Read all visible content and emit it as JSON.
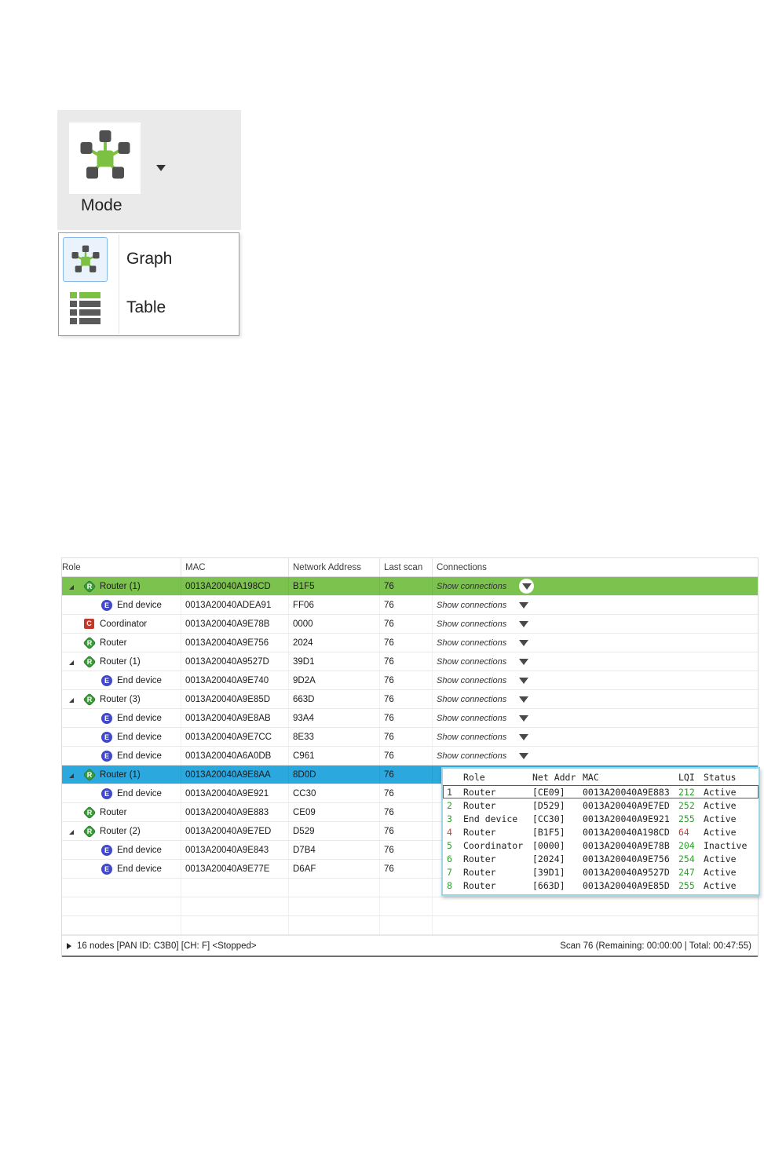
{
  "colors": {
    "green_highlight": "#7CC24E",
    "blue_highlight": "#2BA9DF",
    "accent_green": "#7CC142",
    "icon_dark": "#4F4F4F",
    "lqi_green": "#2E9E2E",
    "lqi_red": "#D23B3B",
    "router_icon": "#3D9B3D",
    "end_device_icon": "#4149C8",
    "coordinator_icon": "#C0392B",
    "selected_item_border": "#86B8E8"
  },
  "mode_widget": {
    "label": "Mode",
    "menu": [
      {
        "label": "Graph",
        "selected": true
      },
      {
        "label": "Table",
        "selected": false
      }
    ]
  },
  "table": {
    "columns": [
      "Role",
      "MAC",
      "Network Address",
      "Last scan",
      "Connections"
    ],
    "show_connections_label": "Show connections",
    "icon_letters": {
      "router": "R",
      "end": "E",
      "coord": "C"
    },
    "rows": [
      {
        "type": "router",
        "expander": true,
        "child": false,
        "role": "Router (1)",
        "mac": "0013A20040A198CD",
        "net": "B1F5",
        "scan": "76",
        "highlight": "green",
        "conn": "circle"
      },
      {
        "type": "end",
        "expander": false,
        "child": true,
        "role": "End device",
        "mac": "0013A20040ADEA91",
        "net": "FF06",
        "scan": "76",
        "highlight": "",
        "conn": "plain"
      },
      {
        "type": "coord",
        "expander": false,
        "child": false,
        "role": "Coordinator",
        "mac": "0013A20040A9E78B",
        "net": "0000",
        "scan": "76",
        "highlight": "",
        "conn": "plain"
      },
      {
        "type": "router",
        "expander": false,
        "child": false,
        "role": "Router",
        "mac": "0013A20040A9E756",
        "net": "2024",
        "scan": "76",
        "highlight": "",
        "conn": "plain"
      },
      {
        "type": "router",
        "expander": true,
        "child": false,
        "role": "Router (1)",
        "mac": "0013A20040A9527D",
        "net": "39D1",
        "scan": "76",
        "highlight": "",
        "conn": "plain"
      },
      {
        "type": "end",
        "expander": false,
        "child": true,
        "role": "End device",
        "mac": "0013A20040A9E740",
        "net": "9D2A",
        "scan": "76",
        "highlight": "",
        "conn": "plain"
      },
      {
        "type": "router",
        "expander": true,
        "child": false,
        "role": "Router (3)",
        "mac": "0013A20040A9E85D",
        "net": "663D",
        "scan": "76",
        "highlight": "",
        "conn": "plain"
      },
      {
        "type": "end",
        "expander": false,
        "child": true,
        "role": "End device",
        "mac": "0013A20040A9E8AB",
        "net": "93A4",
        "scan": "76",
        "highlight": "",
        "conn": "plain"
      },
      {
        "type": "end",
        "expander": false,
        "child": true,
        "role": "End device",
        "mac": "0013A20040A9E7CC",
        "net": "8E33",
        "scan": "76",
        "highlight": "",
        "conn": "plain"
      },
      {
        "type": "end",
        "expander": false,
        "child": true,
        "role": "End device",
        "mac": "0013A20040A6A0DB",
        "net": "C961",
        "scan": "76",
        "highlight": "",
        "conn": "plain"
      },
      {
        "type": "router",
        "expander": true,
        "child": false,
        "role": "Router (1)",
        "mac": "0013A20040A9E8AA",
        "net": "8D0D",
        "scan": "76",
        "highlight": "blue",
        "conn": "none"
      },
      {
        "type": "end",
        "expander": false,
        "child": true,
        "role": "End device",
        "mac": "0013A20040A9E921",
        "net": "CC30",
        "scan": "76",
        "highlight": "",
        "conn": "none"
      },
      {
        "type": "router",
        "expander": false,
        "child": false,
        "role": "Router",
        "mac": "0013A20040A9E883",
        "net": "CE09",
        "scan": "76",
        "highlight": "",
        "conn": "none"
      },
      {
        "type": "router",
        "expander": true,
        "child": false,
        "role": "Router (2)",
        "mac": "0013A20040A9E7ED",
        "net": "D529",
        "scan": "76",
        "highlight": "",
        "conn": "none"
      },
      {
        "type": "end",
        "expander": false,
        "child": true,
        "role": "End device",
        "mac": "0013A20040A9E843",
        "net": "D7B4",
        "scan": "76",
        "highlight": "",
        "conn": "none"
      },
      {
        "type": "end",
        "expander": false,
        "child": true,
        "role": "End device",
        "mac": "0013A20040A9E77E",
        "net": "D6AF",
        "scan": "76",
        "highlight": "",
        "conn": "none"
      }
    ],
    "empty_row_count": 3
  },
  "connections_popup": {
    "columns": [
      "Role",
      "Net Addr",
      "MAC",
      "LQI",
      "Status"
    ],
    "rows": [
      {
        "num": "1",
        "num_color": "dark",
        "role": "Router",
        "net": "[CE09]",
        "mac": "0013A20040A9E883",
        "lqi": "212",
        "lqi_color": "green",
        "status": "Active",
        "selected": true
      },
      {
        "num": "2",
        "num_color": "green",
        "role": "Router",
        "net": "[D529]",
        "mac": "0013A20040A9E7ED",
        "lqi": "252",
        "lqi_color": "green",
        "status": "Active",
        "selected": false
      },
      {
        "num": "3",
        "num_color": "green",
        "role": "End device",
        "net": "[CC30]",
        "mac": "0013A20040A9E921",
        "lqi": "255",
        "lqi_color": "green",
        "status": "Active",
        "selected": false
      },
      {
        "num": "4",
        "num_color": "red",
        "role": "Router",
        "net": "[B1F5]",
        "mac": "0013A20040A198CD",
        "lqi": "64",
        "lqi_color": "red",
        "status": "Active",
        "selected": false
      },
      {
        "num": "5",
        "num_color": "green",
        "role": "Coordinator",
        "net": "[0000]",
        "mac": "0013A20040A9E78B",
        "lqi": "204",
        "lqi_color": "green",
        "status": "Inactive",
        "selected": false
      },
      {
        "num": "6",
        "num_color": "green",
        "role": "Router",
        "net": "[2024]",
        "mac": "0013A20040A9E756",
        "lqi": "254",
        "lqi_color": "green",
        "status": "Active",
        "selected": false
      },
      {
        "num": "7",
        "num_color": "green",
        "role": "Router",
        "net": "[39D1]",
        "mac": "0013A20040A9527D",
        "lqi": "247",
        "lqi_color": "green",
        "status": "Active",
        "selected": false
      },
      {
        "num": "8",
        "num_color": "green",
        "role": "Router",
        "net": "[663D]",
        "mac": "0013A20040A9E85D",
        "lqi": "255",
        "lqi_color": "green",
        "status": "Active",
        "selected": false
      }
    ]
  },
  "status_bar": {
    "left": "16 nodes [PAN ID: C3B0] [CH: F] <Stopped>",
    "right": "Scan 76 (Remaining: 00:00:00 | Total: 00:47:55)"
  }
}
